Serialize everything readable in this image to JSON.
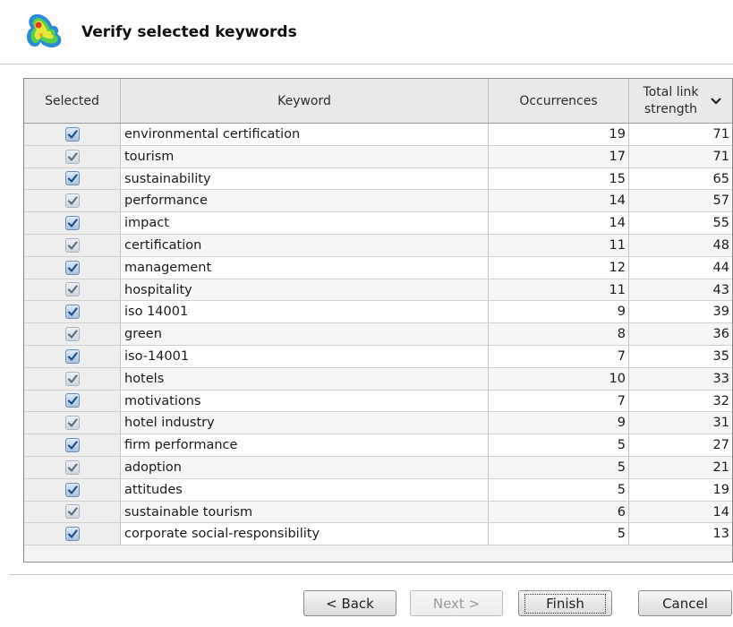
{
  "header": {
    "title": "Verify selected keywords",
    "logo_icon": "vosviewer-density-logo-icon"
  },
  "table": {
    "columns": {
      "selected": "Selected",
      "keyword": "Keyword",
      "occurrences": "Occurrences",
      "total_link_strength": "Total link strength",
      "sort_icon": "chevron-down-icon"
    },
    "rows": [
      {
        "selected": true,
        "keyword": "environmental certification",
        "occurrences": "19",
        "total_link_strength": "71"
      },
      {
        "selected": true,
        "keyword": "tourism",
        "occurrences": "17",
        "total_link_strength": "71"
      },
      {
        "selected": true,
        "keyword": "sustainability",
        "occurrences": "15",
        "total_link_strength": "65"
      },
      {
        "selected": true,
        "keyword": "performance",
        "occurrences": "14",
        "total_link_strength": "57"
      },
      {
        "selected": true,
        "keyword": "impact",
        "occurrences": "14",
        "total_link_strength": "55"
      },
      {
        "selected": true,
        "keyword": "certification",
        "occurrences": "11",
        "total_link_strength": "48"
      },
      {
        "selected": true,
        "keyword": "management",
        "occurrences": "12",
        "total_link_strength": "44"
      },
      {
        "selected": true,
        "keyword": "hospitality",
        "occurrences": "11",
        "total_link_strength": "43"
      },
      {
        "selected": true,
        "keyword": "iso 14001",
        "occurrences": "9",
        "total_link_strength": "39"
      },
      {
        "selected": true,
        "keyword": "green",
        "occurrences": "8",
        "total_link_strength": "36"
      },
      {
        "selected": true,
        "keyword": "iso-14001",
        "occurrences": "7",
        "total_link_strength": "35"
      },
      {
        "selected": true,
        "keyword": "hotels",
        "occurrences": "10",
        "total_link_strength": "33"
      },
      {
        "selected": true,
        "keyword": "motivations",
        "occurrences": "7",
        "total_link_strength": "32"
      },
      {
        "selected": true,
        "keyword": "hotel industry",
        "occurrences": "9",
        "total_link_strength": "31"
      },
      {
        "selected": true,
        "keyword": "firm performance",
        "occurrences": "5",
        "total_link_strength": "27"
      },
      {
        "selected": true,
        "keyword": "adoption",
        "occurrences": "5",
        "total_link_strength": "21"
      },
      {
        "selected": true,
        "keyword": "attitudes",
        "occurrences": "5",
        "total_link_strength": "19"
      },
      {
        "selected": true,
        "keyword": "sustainable tourism",
        "occurrences": "6",
        "total_link_strength": "14"
      },
      {
        "selected": true,
        "keyword": "corporate social-responsibility",
        "occurrences": "5",
        "total_link_strength": "13"
      }
    ]
  },
  "buttons": {
    "back": "< Back",
    "next": "Next >",
    "finish": "Finish",
    "cancel": "Cancel"
  },
  "colors": {
    "checkbox_check": "#1f4f86",
    "header_bg": "#e9e9e9"
  }
}
